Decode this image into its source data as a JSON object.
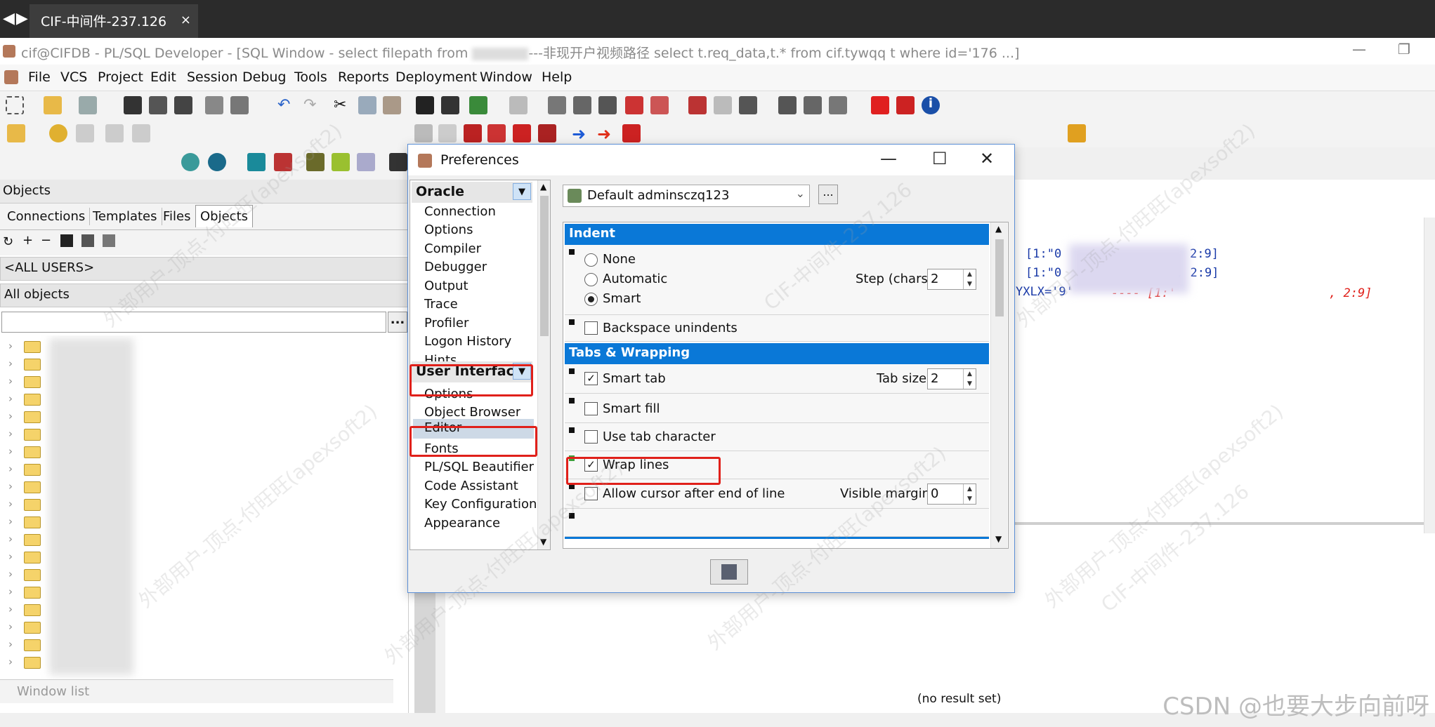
{
  "remote_tabbar": {
    "nav_arrows": "◀▶",
    "tab_title": "CIF-中间件-237.126",
    "tab_close": "×"
  },
  "window": {
    "title_prefix": "cif@CIFDB - PL/SQL Developer - [SQL Window - select filepath from ",
    "title_suffix": "---非现开户视频路径 select t.req_data,t.* from cif.tywqq t where id='176 ...]",
    "min": "—",
    "restore": "❐"
  },
  "menu": [
    "File",
    "VCS",
    "Project",
    "Edit",
    "Session",
    "Debug",
    "Tools",
    "Reports",
    "Deployment",
    "Window",
    "Help"
  ],
  "objects_panel": {
    "header": "Objects",
    "tabs": [
      "Connections",
      "Templates",
      "Files",
      "Objects"
    ],
    "users_filter": "<ALL USERS>",
    "objects_filter": "All objects",
    "search_btn": "...",
    "window_list": "Window list"
  },
  "editor": {
    "lines": [
      "[1:\"0",
      "2:9]",
      "[1:\"0",
      ", 2:9]",
      "YXLX='9'",
      "---- [1:'",
      ", 2:9]"
    ],
    "no_result": "(no result set)"
  },
  "dialog": {
    "title": "Preferences",
    "min": "—",
    "max": "☐",
    "close": "✕",
    "profile": "Default adminsczq123",
    "profile_btn": "...",
    "nav": {
      "oracle": "Oracle",
      "oracle_items": [
        "Connection",
        "Options",
        "Compiler",
        "Debugger",
        "Output",
        "Trace",
        "Profiler",
        "Logon History",
        "Hints"
      ],
      "ui": "User Interface",
      "ui_items": [
        "Options",
        "Object Browser",
        "Editor",
        "Fonts",
        "PL/SQL Beautifier",
        "Code Assistant",
        "Key Configuration",
        "Appearance"
      ],
      "selected": "Editor"
    },
    "indent": {
      "header": "Indent",
      "none": "None",
      "automatic": "Automatic",
      "smart": "Smart",
      "step_label": "Step (chars)",
      "step_value": "2",
      "backspace": "Backspace unindents"
    },
    "tabs_wrapping": {
      "header": "Tabs & Wrapping",
      "smart_tab": "Smart tab",
      "tab_size_label": "Tab size",
      "tab_size_value": "2",
      "smart_fill": "Smart fill",
      "use_tab_char": "Use tab character",
      "wrap_lines": "Wrap lines",
      "allow_cursor": "Allow cursor after end of line",
      "visible_margin_label": "Visible margin",
      "visible_margin_value": "0"
    },
    "checked": {
      "smart_tab": "✓",
      "wrap_lines": "✓"
    }
  },
  "watermark": {
    "text": "外部用户-顶点-付旺旺(apexsoft2)",
    "text2": "CIF-中间件-237.126",
    "brand": "CSDN @也要大步向前呀"
  },
  "colors": {
    "accent_header": "#0a78d7",
    "highlight_box": "#e0201a"
  }
}
